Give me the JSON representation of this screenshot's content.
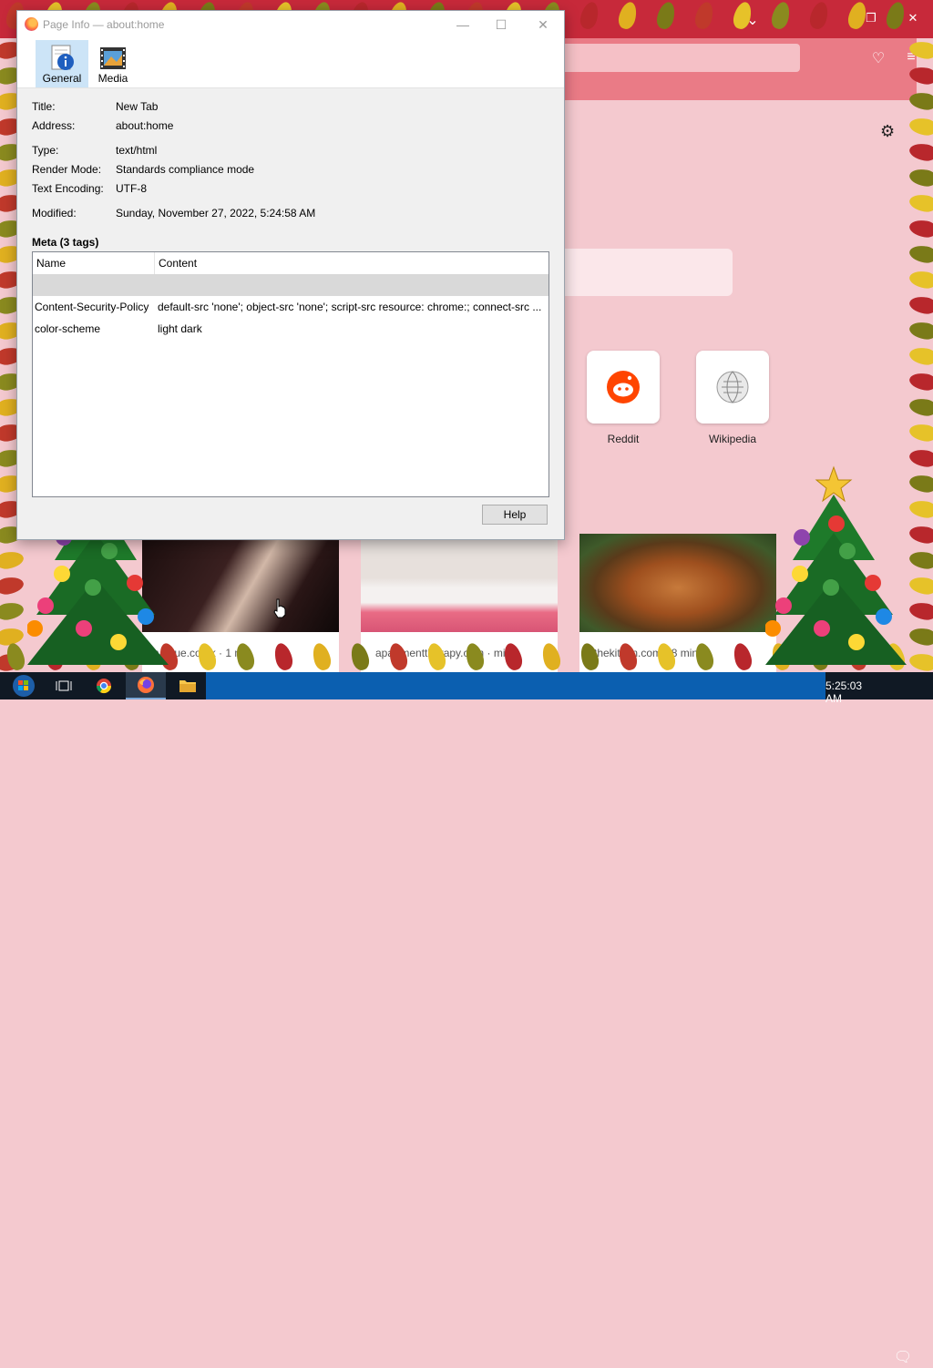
{
  "dialog": {
    "title": "Page Info — about:home",
    "tabs": [
      {
        "label": "General",
        "selected": true
      },
      {
        "label": "Media",
        "selected": false
      }
    ],
    "fields": [
      {
        "key": "Title:",
        "value": "New Tab"
      },
      {
        "key": "Address:",
        "value": "about:home"
      },
      {
        "key": "Type:",
        "value": "text/html"
      },
      {
        "key": "Render Mode:",
        "value": "Standards compliance mode"
      },
      {
        "key": "Text Encoding:",
        "value": "UTF-8"
      },
      {
        "key": "Modified:",
        "value": "Sunday, November 27, 2022, 5:24:58 AM"
      }
    ],
    "meta_heading": "Meta (3 tags)",
    "meta_table": {
      "columns": [
        "Name",
        "Content"
      ],
      "rows": [
        {
          "name": "",
          "content": "",
          "selected": true
        },
        {
          "name": "Content-Security-Policy",
          "content": "default-src 'none'; object-src 'none'; script-src resource: chrome:; connect-src ..."
        },
        {
          "name": "color-scheme",
          "content": "light dark"
        }
      ]
    },
    "help_label": "Help"
  },
  "newtab": {
    "shortcuts": [
      {
        "label": "Reddit"
      },
      {
        "label": "Wikipedia"
      }
    ],
    "stories": [
      {
        "source": "vogue.co.uk · 1 min",
        "title": "..."
      },
      {
        "source": "apartmenttherapy.com · min",
        "title": "..."
      },
      {
        "source": "thekitchn.com · 8 min",
        "title": "..."
      }
    ]
  },
  "taskbar": {
    "clock": "5:25:03 AM"
  },
  "colors": {
    "titlebar": "#c7293a",
    "toolbar": "#ea7b86",
    "newtab_bg": "#f4c9cf",
    "taskbar": "#101924",
    "taskbar_accent": "#0b5fb0",
    "selected_tab": "#cce4f7"
  }
}
